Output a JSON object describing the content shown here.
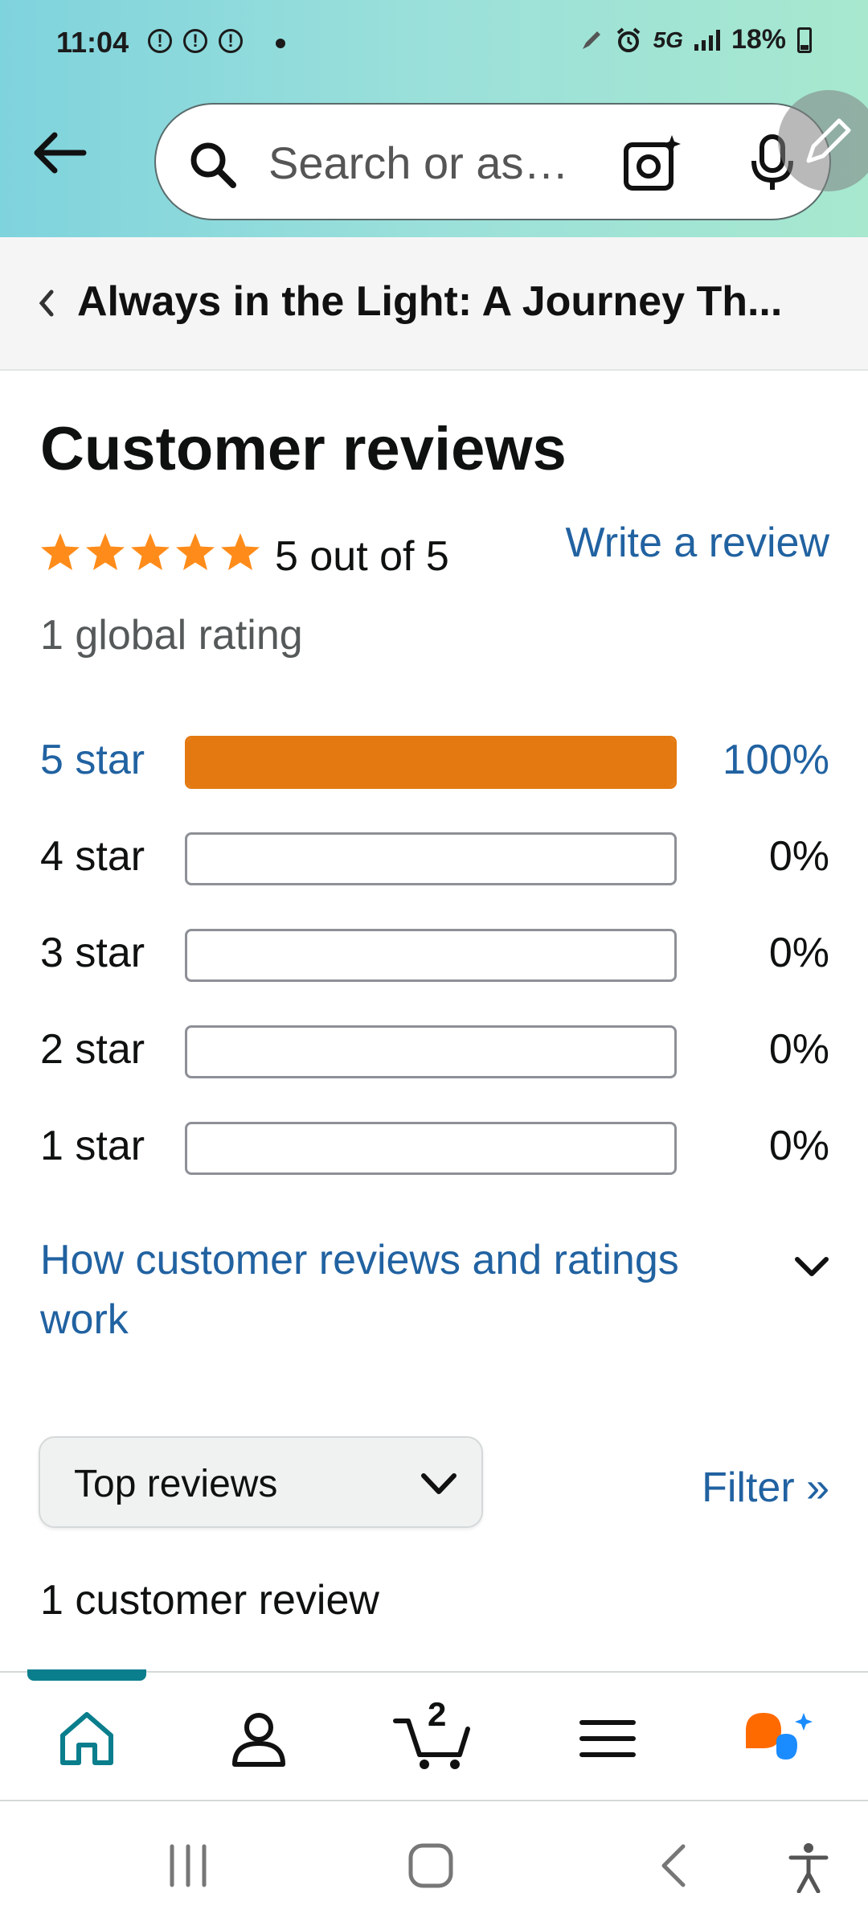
{
  "status_bar": {
    "time": "11:04",
    "alert_glyph": "!",
    "network": "5G",
    "battery": "18%"
  },
  "search": {
    "placeholder": "Search or as…"
  },
  "breadcrumb": {
    "title": "Always in the Light: A Journey Th..."
  },
  "reviews": {
    "heading": "Customer reviews",
    "rating_value": 5,
    "rating_text": "5 out of 5",
    "write_review": "Write a review",
    "global_rating": "1 global rating",
    "histogram": [
      {
        "label": "5 star",
        "percent": "100%",
        "fraction": 1.0,
        "is_link": true
      },
      {
        "label": "4 star",
        "percent": "0%",
        "fraction": 0.0,
        "is_link": false
      },
      {
        "label": "3 star",
        "percent": "0%",
        "fraction": 0.0,
        "is_link": false
      },
      {
        "label": "2 star",
        "percent": "0%",
        "fraction": 0.0,
        "is_link": false
      },
      {
        "label": "1 star",
        "percent": "0%",
        "fraction": 0.0,
        "is_link": false
      }
    ],
    "how_it_works": "How customer reviews and ratings work",
    "sort_selected": "Top reviews",
    "filter": "Filter »",
    "review_count": "1 customer review"
  },
  "bottom_nav": {
    "cart_count": "2",
    "items": [
      "home-icon",
      "account-icon",
      "cart-icon",
      "menu-icon",
      "rufus-assistant-icon"
    ]
  },
  "colors": {
    "link": "#2162a1",
    "star": "#ff8c1a",
    "bar_fill": "#e47911",
    "accent": "#0a7e8c"
  }
}
